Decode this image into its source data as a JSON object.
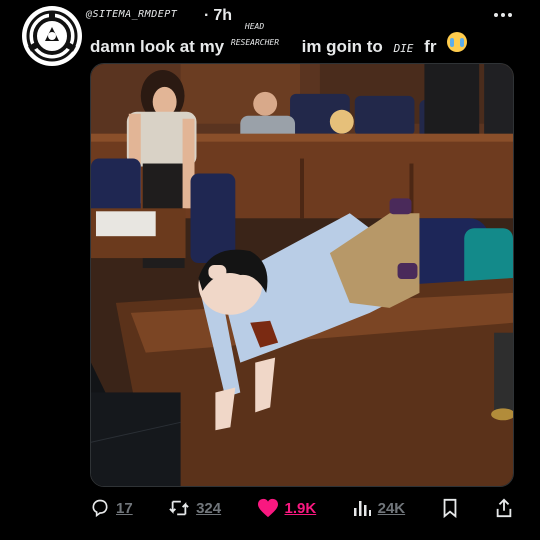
{
  "post": {
    "username": "@SITEMA_RMDEPT",
    "time_dot": "·",
    "time": "7h",
    "more_icon": "more-horizontal-icon",
    "avatar_icon": "scp-logo-icon",
    "text": {
      "part1": "damn look at my",
      "handwritten_top": "HEAD",
      "handwritten_bottom": "RESEARCHER",
      "part2": "im goin to",
      "handwritten_die": "DIE",
      "part3": "fr",
      "emoji": "loudly-crying-face-emoji"
    }
  },
  "media": {
    "description_icon": "courtroom-meme-image"
  },
  "actions": {
    "reply": {
      "icon": "reply-icon",
      "count": "17"
    },
    "retweet": {
      "icon": "retweet-icon",
      "count": "324"
    },
    "like": {
      "icon": "heart-icon",
      "count": "1.9K",
      "color": "#f91880"
    },
    "views": {
      "icon": "views-icon",
      "count": "24K"
    },
    "bookmark": {
      "icon": "bookmark-icon"
    },
    "share": {
      "icon": "share-icon"
    }
  }
}
